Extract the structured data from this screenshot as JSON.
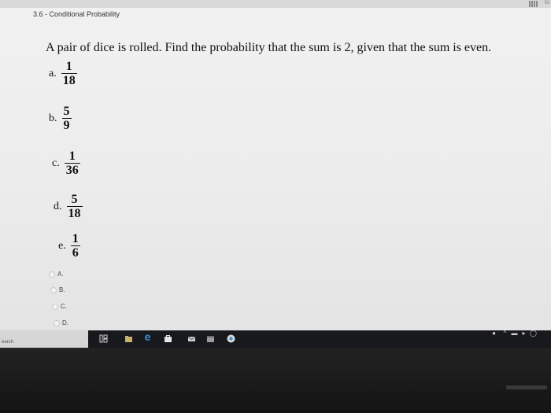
{
  "header": {
    "title": "3.6 - Conditional Probability"
  },
  "question": {
    "text": "A pair of dice is rolled. Find the probability that the sum is 2, given that the sum is even.",
    "options": [
      {
        "letter": "a.",
        "numerator": "1",
        "denominator": "18"
      },
      {
        "letter": "b.",
        "numerator": "5",
        "denominator": "9"
      },
      {
        "letter": "c.",
        "numerator": "1",
        "denominator": "36"
      },
      {
        "letter": "d.",
        "numerator": "5",
        "denominator": "18"
      },
      {
        "letter": "e.",
        "numerator": "1",
        "denominator": "6"
      }
    ]
  },
  "answer_choices": [
    {
      "label": "A."
    },
    {
      "label": "B."
    },
    {
      "label": "C."
    },
    {
      "label": "D."
    }
  ],
  "taskbar": {
    "search_label": "earch",
    "corner_text": "Sli",
    "icons": [
      "mic-icon",
      "task-view-icon",
      "file-explorer-icon",
      "edge-icon",
      "store-icon",
      "mail-icon",
      "calendar-icon",
      "chrome-icon"
    ]
  },
  "colors": {
    "page_bg": "#ececec",
    "taskbar": "#17191c",
    "edge_blue": "#3a8fd6",
    "chrome_ring": "#d9d9d9"
  }
}
